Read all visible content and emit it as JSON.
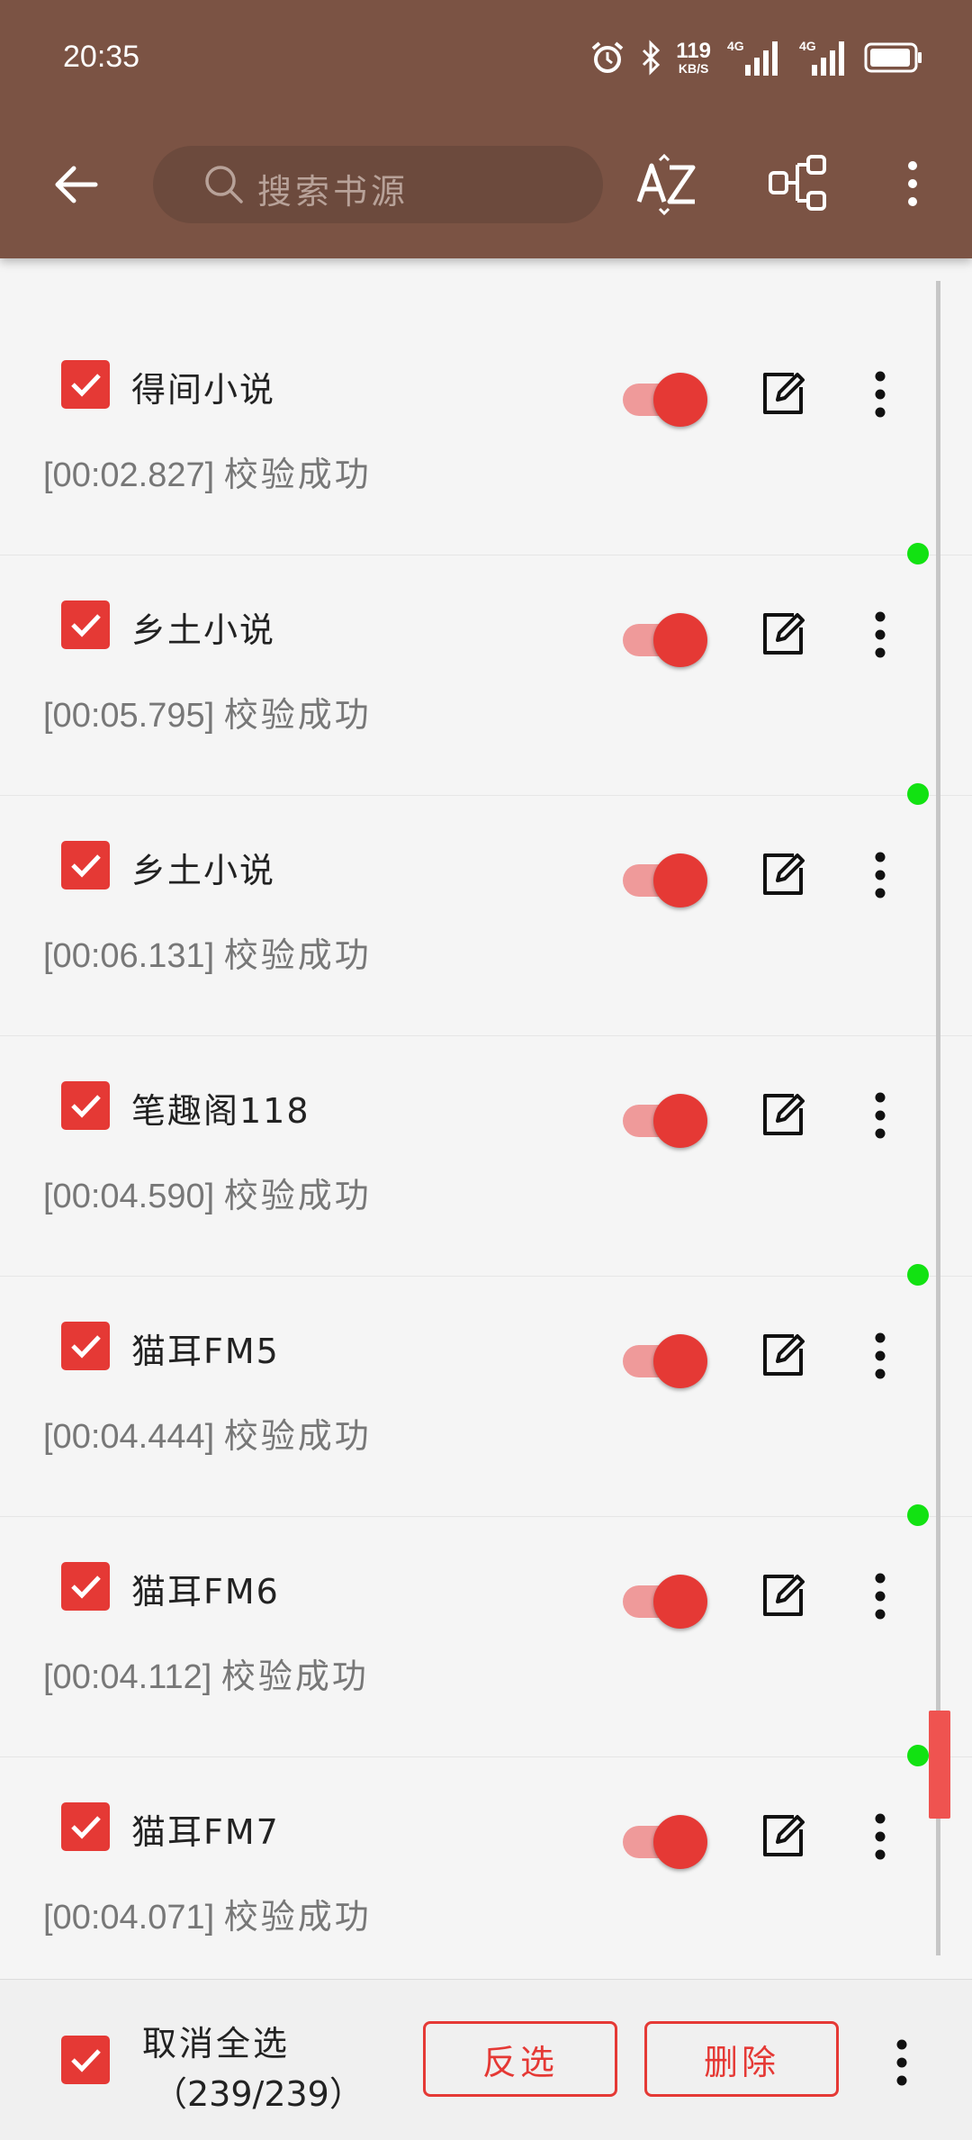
{
  "status_bar": {
    "time": "20:35",
    "net_speed_value": "119",
    "net_speed_unit": "KB/S",
    "network_1": "4G",
    "network_2": "4G",
    "icons": [
      "alarm-icon",
      "bluetooth-icon",
      "signal-4g-icon",
      "signal-4g-icon",
      "battery-icon"
    ]
  },
  "toolbar": {
    "search_placeholder": "搜索书源",
    "icons": [
      "back-arrow-icon",
      "search-icon",
      "sort-az-icon",
      "group-icon",
      "more-vert-icon"
    ]
  },
  "sources": [
    {
      "name": "得间小说",
      "log": "[00:02.827]",
      "status": "校验成功",
      "enabled": true,
      "checked": true,
      "new_dot": false
    },
    {
      "name": "乡土小说",
      "log": "[00:05.795]",
      "status": "校验成功",
      "enabled": true,
      "checked": true,
      "new_dot": true
    },
    {
      "name": "乡土小说",
      "log": "[00:06.131]",
      "status": "校验成功",
      "enabled": true,
      "checked": true,
      "new_dot": true
    },
    {
      "name": "笔趣阁118",
      "log": "[00:04.590]",
      "status": "校验成功",
      "enabled": true,
      "checked": true,
      "new_dot": false
    },
    {
      "name": "猫耳FM5",
      "log": "[00:04.444]",
      "status": "校验成功",
      "enabled": true,
      "checked": true,
      "new_dot": true
    },
    {
      "name": "猫耳FM6",
      "log": "[00:04.112]",
      "status": "校验成功",
      "enabled": true,
      "checked": true,
      "new_dot": true
    },
    {
      "name": "猫耳FM7",
      "log": "[00:04.071]",
      "status": "校验成功",
      "enabled": true,
      "checked": true,
      "new_dot": true
    }
  ],
  "bottom_bar": {
    "select_all_label": "取消全选",
    "select_count": "（239/239）",
    "invert_label": "反选",
    "delete_label": "删除"
  },
  "colors": {
    "appbar": "#7b5344",
    "accent": "#e53935",
    "switch_track": "#ef9a9a",
    "new_dot": "#12e212"
  }
}
